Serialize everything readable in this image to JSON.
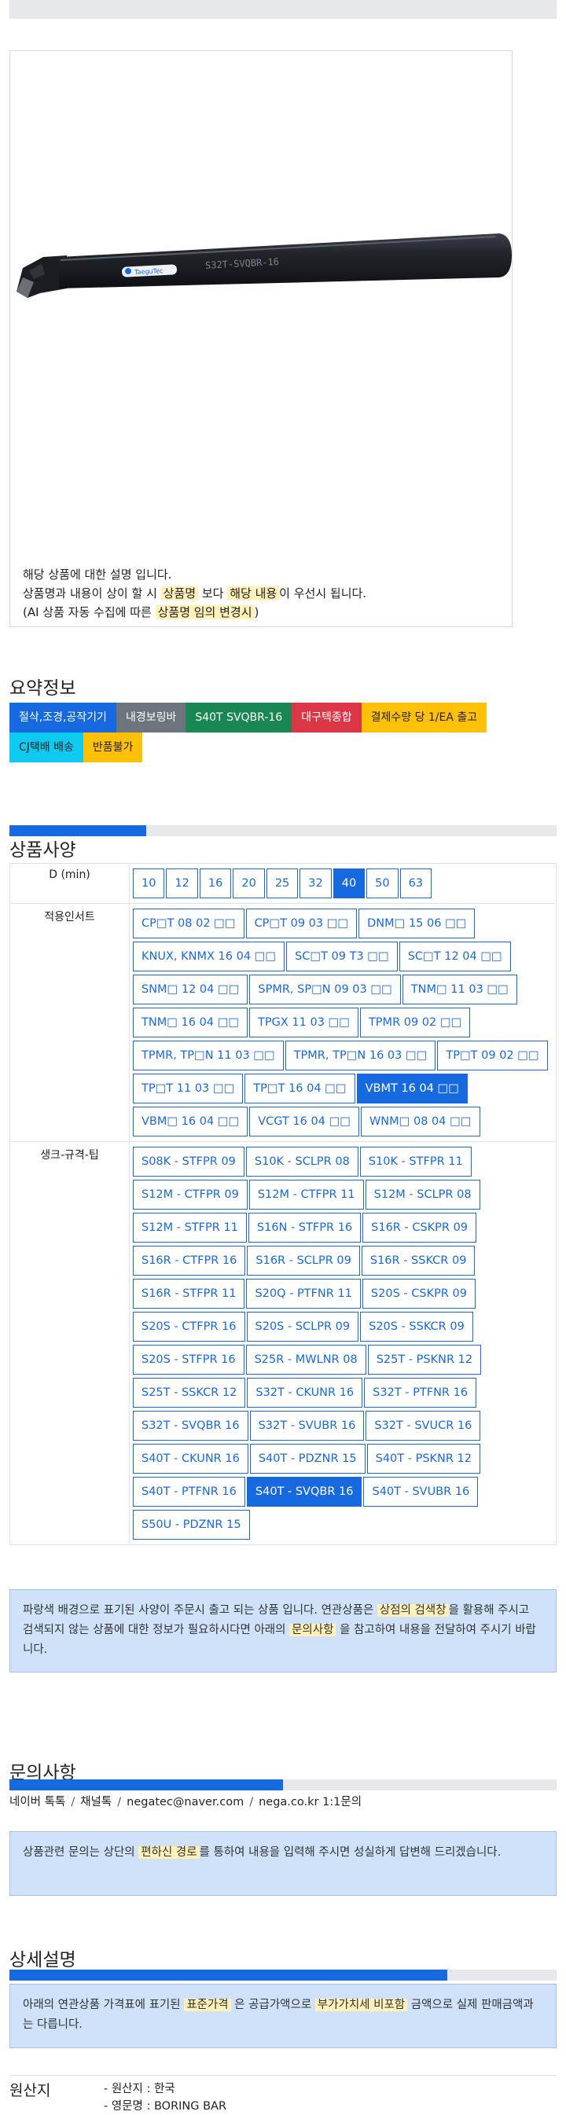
{
  "product": {
    "image_label": "S32T-SVQBR-16",
    "brand_logo": "TaeguTec",
    "desc_line1": "해당 상품에 대한 설명 입니다.",
    "desc_line2_a": "상품명과 내용이 상이 할 시 ",
    "desc_line2_hl1": "상품명",
    "desc_line2_b": " 보다 ",
    "desc_line2_hl2": "해당 내용",
    "desc_line2_c": "이 우선시 됩니다.",
    "desc_line3_a": "(AI 상품 자동 수집에 따른 ",
    "desc_line3_hl": "상품명 임의 변경시",
    "desc_line3_b": ")"
  },
  "summary": {
    "title": "요약정보",
    "tags": [
      {
        "label": "절삭,조경,공작기기",
        "color": "#1769e0",
        "text_color": "#ffffff"
      },
      {
        "label": "내경보링바",
        "color": "#6c757d",
        "text_color": "#ffffff"
      },
      {
        "label": "S40T SVQBR-16",
        "color": "#198754",
        "text_color": "#ffffff"
      },
      {
        "label": "대구텍종합",
        "color": "#dc3545",
        "text_color": "#ffffff"
      },
      {
        "label": "결제수량 당 1/EA 출고",
        "color": "#ffc107",
        "text_color": "#222222"
      },
      {
        "label": "CJ택배 배송",
        "color": "#0dcaf0",
        "text_color": "#222222"
      },
      {
        "label": "반품불가",
        "color": "#ffc107",
        "text_color": "#222222"
      }
    ]
  },
  "spec": {
    "title": "상품사양",
    "progress": 0.25,
    "rows": [
      {
        "label": "D (min)",
        "options": [
          "10",
          "12",
          "16",
          "20",
          "25",
          "32",
          "40",
          "50",
          "63"
        ],
        "selected": "40"
      },
      {
        "label": "적용인서트",
        "options": [
          "CP□T 08 02 □□",
          "CP□T 09 03 □□",
          "DNM□ 15 06 □□",
          "KNUX, KNMX 16 04 □□",
          "SC□T 09 T3 □□",
          "SC□T 12 04 □□",
          "SNM□ 12 04 □□",
          "SPMR, SP□N 09 03 □□",
          "TNM□ 11 03 □□",
          "TNM□ 16 04 □□",
          "TPGX 11 03 □□",
          "TPMR 09 02 □□",
          "TPMR, TP□N 11 03 □□",
          "TPMR, TP□N 16 03 □□",
          "TP□T 09 02 □□",
          "TP□T 11 03 □□",
          "TP□T 16 04 □□",
          "VBMT 16 04 □□",
          "VBM□ 16 04 □□",
          "VCGT 16 04 □□",
          "WNM□ 08 04 □□"
        ],
        "selected": "VBMT 16 04 □□"
      },
      {
        "label": "생크-규격-팁",
        "options": [
          "S08K - STFPR 09",
          "S10K - SCLPR 08",
          "S10K - STFPR 11",
          "S12M - CTFPR 09",
          "S12M - CTFPR 11",
          "S12M - SCLPR 08",
          "S12M - STFPR 11",
          "S16N - STFPR 16",
          "S16R - CSKPR 09",
          "S16R - CTFPR 16",
          "S16R - SCLPR 09",
          "S16R - SSKCR 09",
          "S16R - STFPR 11",
          "S20Q - PTFNR 11",
          "S20S - CSKPR 09",
          "S20S - CTFPR 16",
          "S20S - SCLPR 09",
          "S20S - SSKCR 09",
          "S20S - STFPR 16",
          "S25R - MWLNR 08",
          "S25T - PSKNR 12",
          "S25T - SSKCR 12",
          "S32T - CKUNR 16",
          "S32T - PTFNR 16",
          "S32T - SVQBR 16",
          "S32T - SVUBR 16",
          "S32T - SVUCR 16",
          "S40T - CKUNR 16",
          "S40T - PDZNR 15",
          "S40T - PSKNR 12",
          "S40T - PTFNR 16",
          "S40T - SVQBR 16",
          "S40T - SVUBR 16",
          "S50U - PDZNR 15"
        ],
        "selected": "S40T - SVQBR 16"
      }
    ],
    "notice_a": "파랑색 배경으로 표기된 사양이 주문시 출고 되는 상품 입니다. 연관상품은 ",
    "notice_hl1": "상점의 검색창",
    "notice_b": "을 활용해 주시고 검색되지 않는 상품에 대한 정보가 필요하시다면 아래의 ",
    "notice_hl2": "문의사항",
    "notice_c": " 을 참고하여 내용을 전달하여 주시기 바랍니다."
  },
  "inquiry": {
    "title": "문의사항",
    "progress": 0.5,
    "contacts": [
      "네이버 톡톡",
      "채널톡",
      "negatec@naver.com",
      "nega.co.kr 1:1문의"
    ],
    "notice_a": "상품관련 문의는 상단의 ",
    "notice_hl": "편하신 경로",
    "notice_b": "를 통하여 내용을 입력해 주시면 성실하게 답변해 드리겠습니다."
  },
  "detail": {
    "title": "상세설명",
    "progress": 0.8,
    "notice_a": "아래의 연관상품 가격표에 표기된 ",
    "notice_hl1": "표준가격",
    "notice_b": " 은 공급가액으로 ",
    "notice_hl2": "부가가치세 비포함",
    "notice_c": " 금액으로 실제 판매금액과는 다릅니다."
  },
  "origin": {
    "label": "원산지",
    "items": [
      "- 원산지 : 한국",
      "- 영문명 : BORING BAR"
    ]
  },
  "colors": {
    "accent": "#1769e0",
    "notice_bg": "#cfe2fa",
    "highlight": "#fff1b8"
  }
}
